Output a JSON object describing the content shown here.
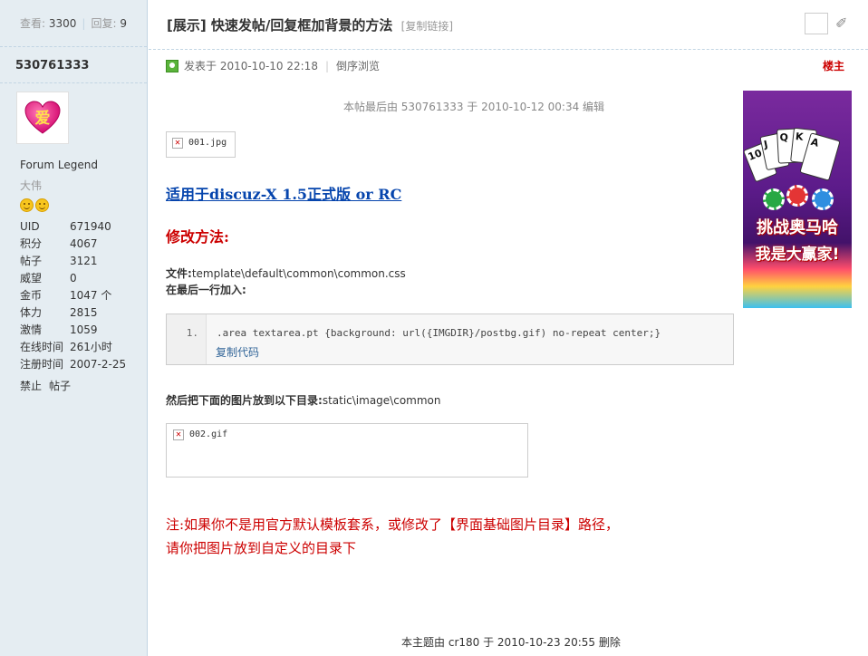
{
  "side": {
    "views_label": "查看:",
    "views": "3300",
    "replies_label": "回复:",
    "replies": "9",
    "author": "530761333",
    "avatar_text": "爱",
    "rank": "Forum Legend",
    "rank2": "大伟",
    "stats": [
      {
        "k": "UID",
        "v": "671940"
      },
      {
        "k": "积分",
        "v": "4067"
      },
      {
        "k": "帖子",
        "v": "3121"
      },
      {
        "k": "威望",
        "v": "0"
      },
      {
        "k": "金币",
        "v": "1047 个"
      },
      {
        "k": "体力",
        "v": "2815"
      },
      {
        "k": "激情",
        "v": "1059"
      },
      {
        "k": "在线时间",
        "v": "261小时"
      },
      {
        "k": "注册时间",
        "v": "2007-2-25"
      }
    ],
    "ban": "禁止",
    "posts": "帖子"
  },
  "header": {
    "title": "[展示] 快速发帖/回复框加背景的方法",
    "copy_link": "[复制链接]"
  },
  "meta": {
    "posted": "发表于  2010-10-10 22:18",
    "reverse": "倒序浏览",
    "op": "楼主"
  },
  "post": {
    "edited": "本帖最后由 530761333 于 2010-10-12 00:34 编辑",
    "attach1": "001.jpg",
    "link": "适用于discuz-X 1.5正式版  or RC",
    "method": "修改方法:",
    "file_label": "文件:",
    "file_path": "template\\default\\common\\common.css",
    "last_line": "在最后一行加入:",
    "code_line_no": "1.",
    "code": ".area textarea.pt {background: url({IMGDIR}/postbg.gif) no-repeat center;}",
    "copy_code": "复制代码",
    "then_label": "然后把下面的图片放到以下目录:",
    "then_path": "static\\image\\common",
    "attach2": "002.gif",
    "note_line1": "注:如果你不是用官方默认模板套系，或修改了【界面基础图片目录】路径，",
    "note_line2": "请你把图片放到自定义的目录下"
  },
  "ad": {
    "line1": "挑战奥马哈",
    "line2": "我是大赢家!",
    "cards": [
      "10",
      "J",
      "Q",
      "K",
      "A"
    ]
  },
  "footer": {
    "text": "本主题由",
    "who": "cr180",
    "when": "于  2010-10-23 20:55",
    "action": "删除"
  }
}
